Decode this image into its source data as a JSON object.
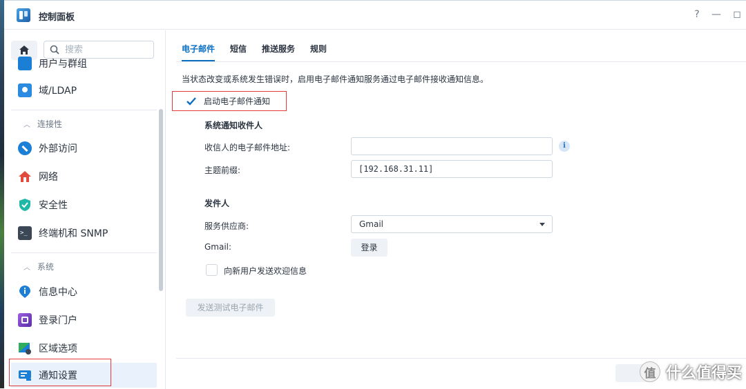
{
  "window": {
    "title": "控制面板"
  },
  "titlebar": {
    "help_icon": "?",
    "minimize_icon": "—",
    "maximize_icon": "◻"
  },
  "sidebar": {
    "search_placeholder": "搜索",
    "items": [
      {
        "label": "用户与群组",
        "icon": "user-group-icon",
        "color": "#1b7fd6"
      },
      {
        "label": "域/LDAP",
        "icon": "domain-ldap-icon",
        "color": "#2a8be0"
      },
      {
        "label": "外部访问",
        "icon": "external-access-icon",
        "color": "#1b7fd6"
      },
      {
        "label": "网络",
        "icon": "network-house-icon",
        "color": "#e24a3b"
      },
      {
        "label": "安全性",
        "icon": "shield-icon",
        "color": "#1fb8a6"
      },
      {
        "label": "终端机和 SNMP",
        "icon": "terminal-icon",
        "color": "#3b4754"
      },
      {
        "label": "信息中心",
        "icon": "info-center-icon",
        "color": "#1b7fd6"
      },
      {
        "label": "登录门户",
        "icon": "login-portal-icon",
        "color": "#7a3fc2"
      },
      {
        "label": "区域选项",
        "icon": "regional-options-icon",
        "color": "#2fae5b"
      },
      {
        "label": "通知设置",
        "icon": "notification-icon",
        "color": "#1b7fd6"
      }
    ],
    "sections": {
      "connectivity": "连接性",
      "system": "系统"
    }
  },
  "tabs": [
    "电子邮件",
    "短信",
    "推送服务",
    "规则"
  ],
  "main": {
    "description": "当状态改变或系统发生错误时，启用电子邮件通知服务通过电子邮件接收通知信息。",
    "enable_label": "启动电子邮件通知",
    "enable_checked": true,
    "recipient_heading": "系统通知收件人",
    "recipient_email_label": "收信人的电子邮件地址:",
    "recipient_email_value": "",
    "subject_prefix_label": "主题前缀:",
    "subject_prefix_value": "[192.168.31.11]",
    "sender_heading": "发件人",
    "provider_label": "服务供应商:",
    "provider_value": "Gmail",
    "gmail_label": "Gmail:",
    "login_button": "登录",
    "welcome_label": "向新用户发送欢迎信息",
    "welcome_checked": false,
    "test_button": "发送测试电子邮件"
  },
  "watermark": {
    "badge": "值",
    "text": "什么值得买"
  },
  "colors": {
    "accent": "#0a6fc2",
    "highlight_box": "#e5393b",
    "active_row": "#e8f1fc"
  }
}
